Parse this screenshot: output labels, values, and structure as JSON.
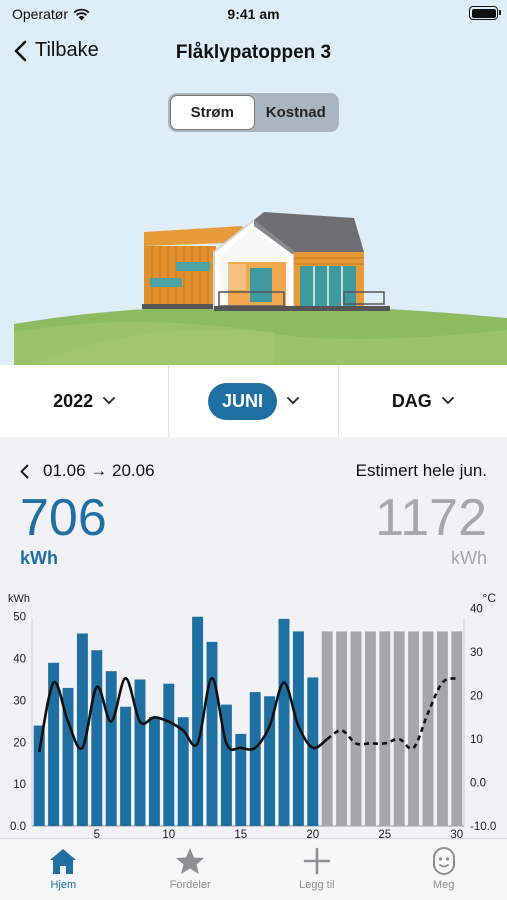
{
  "status": {
    "carrier": "Operatør",
    "time": "9:41 am"
  },
  "nav": {
    "back_label": "Tilbake",
    "title": "Flåklypatoppen 3"
  },
  "segment": [
    {
      "label": "Strøm",
      "active": true
    },
    {
      "label": "Kostnad",
      "active": false
    }
  ],
  "selectors": {
    "year": "2022",
    "month": "JUNI",
    "resolution": "DAG"
  },
  "summary": {
    "period": "01.06 → 20.06",
    "estimate_label": "Estimert hele jun.",
    "current_value": "706",
    "current_unit": "kWh",
    "estimate_value": "1172",
    "estimate_unit": "kWh"
  },
  "colors": {
    "accent": "#1f6fa2",
    "estimate_bar": "#a7a7aa",
    "temperature_line": "#111111"
  },
  "chart_data": {
    "type": "bar",
    "left_axis_label": "kWh",
    "right_axis_label": "°C",
    "left_ticks": [
      "50",
      "40",
      "30",
      "20",
      "10",
      "0.0"
    ],
    "right_ticks": [
      "40",
      "30",
      "20",
      "10",
      "0.0",
      "-10.0"
    ],
    "x_ticks": [
      "5",
      "10",
      "15",
      "20",
      "25",
      "30"
    ],
    "ylim": [
      0,
      54
    ],
    "y2lim": [
      -10,
      42
    ],
    "days": [
      1,
      2,
      3,
      4,
      5,
      6,
      7,
      8,
      9,
      10,
      11,
      12,
      13,
      14,
      15,
      16,
      17,
      18,
      19,
      20,
      21,
      22,
      23,
      24,
      25,
      26,
      27,
      28,
      29,
      30
    ],
    "series": [
      {
        "kind": "measured",
        "values": [
          24,
          39,
          33,
          46,
          42,
          37,
          28.5,
          35,
          26,
          34,
          26,
          50,
          44,
          29,
          22,
          32,
          31,
          49.5,
          46.5,
          35.5,
          null,
          null,
          null,
          null,
          null,
          null,
          null,
          null,
          null,
          null
        ]
      },
      {
        "kind": "estimated",
        "values": [
          null,
          null,
          null,
          null,
          null,
          null,
          null,
          null,
          null,
          null,
          null,
          null,
          null,
          null,
          null,
          null,
          null,
          null,
          null,
          null,
          46.5,
          46.5,
          46.5,
          46.5,
          46.5,
          46.5,
          46.5,
          46.5,
          46.5,
          46.5
        ]
      },
      {
        "kind": "temperature",
        "values": [
          7,
          23,
          14,
          8,
          22,
          14,
          24,
          14,
          15,
          14,
          12,
          9,
          24,
          9,
          8,
          8,
          13,
          23,
          13,
          8,
          10,
          12,
          9,
          9,
          9,
          10,
          8,
          16,
          23,
          24
        ]
      }
    ]
  },
  "tabs": [
    {
      "label": "Hjem",
      "icon": "home-icon",
      "active": true
    },
    {
      "label": "Fordeler",
      "icon": "star-icon",
      "active": false
    },
    {
      "label": "Legg til",
      "icon": "plus-icon",
      "active": false
    },
    {
      "label": "Meg",
      "icon": "face-icon",
      "active": false
    }
  ]
}
